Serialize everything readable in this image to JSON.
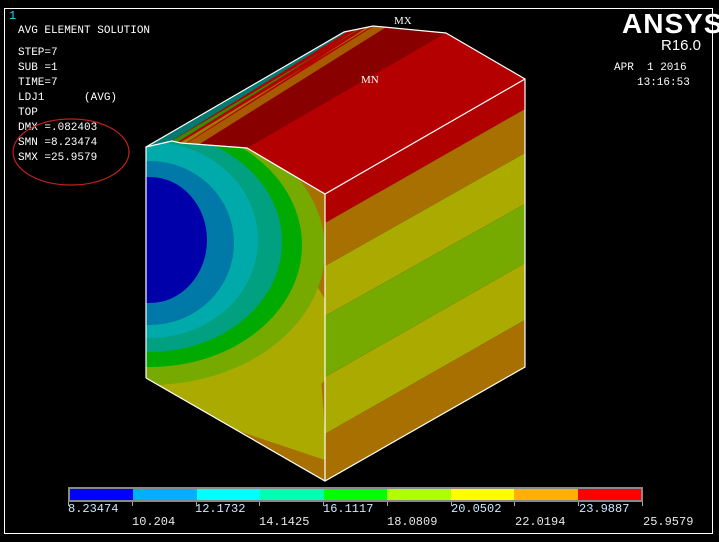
{
  "window_number": "1",
  "brand": {
    "logo": "ANSYS",
    "release": "R16.0"
  },
  "header": {
    "date": "APR  1 2016",
    "time": "13:16:53"
  },
  "info": {
    "title": "AVG ELEMENT SOLUTION",
    "step": "STEP=7",
    "sub": "SUB =1",
    "time": "TIME=7",
    "item": "LDJ1      (AVG)",
    "layer": "TOP",
    "dmx": "DMX =.082403",
    "smn": "SMN =8.23474",
    "smx": "SMX =25.9579"
  },
  "markers": {
    "max": "MX",
    "min": "MN"
  },
  "legend": {
    "colors": [
      "#0000ff",
      "#00b0ff",
      "#00ffff",
      "#00ffb0",
      "#00ff00",
      "#b0ff00",
      "#ffff00",
      "#ffb000",
      "#ff0000"
    ],
    "upper_labels": [
      "8.23474",
      "12.1732",
      "16.1117",
      "20.0502",
      "23.9887"
    ],
    "lower_labels": [
      "10.204",
      "14.1425",
      "18.0809",
      "22.0194",
      "25.9579"
    ]
  }
}
